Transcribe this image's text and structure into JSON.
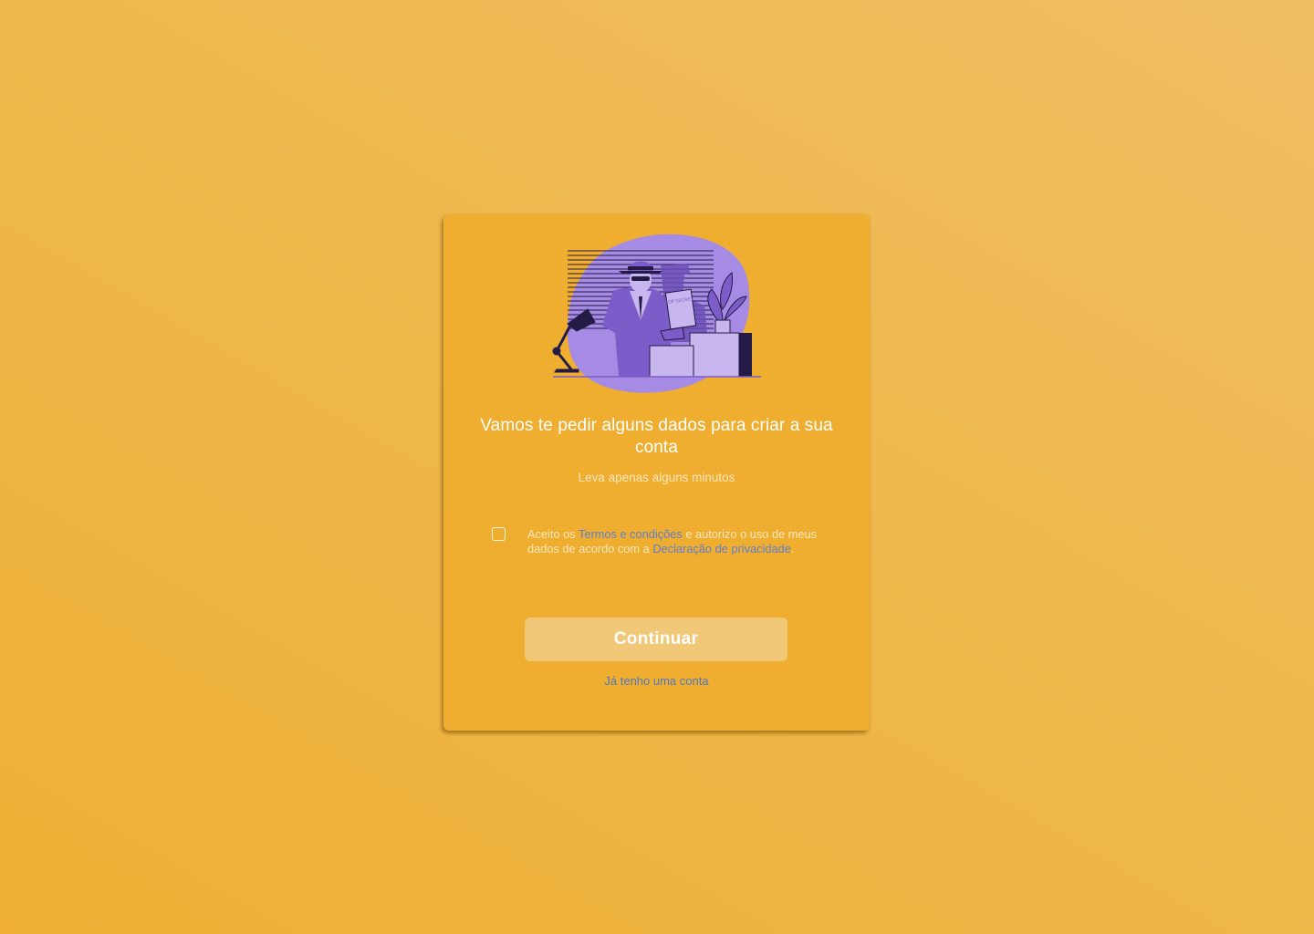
{
  "illustration": {
    "paper_label": "TOP SECRET",
    "colors": {
      "blob": "#a58be3",
      "dark": "#231b45",
      "mid": "#7c5cc8",
      "light": "#c8b7ef"
    }
  },
  "signup": {
    "title": "Vamos te pedir alguns dados para criar a sua conta",
    "subtitle": "Leva apenas alguns minutos",
    "terms": {
      "checked": false,
      "text_1": "Aceito os ",
      "link_terms": "Termos e condições",
      "text_2": " e autorizo o uso de meus dados de acordo com a ",
      "link_privacy": "Declaração de privacidade",
      "text_3": "."
    },
    "continue_label": "Continuar",
    "login_link": "Já tenho uma conta"
  },
  "colors": {
    "background": "#efb44a",
    "card": "#efae30",
    "button": "#f0c877",
    "link": "#5f7fd0"
  }
}
